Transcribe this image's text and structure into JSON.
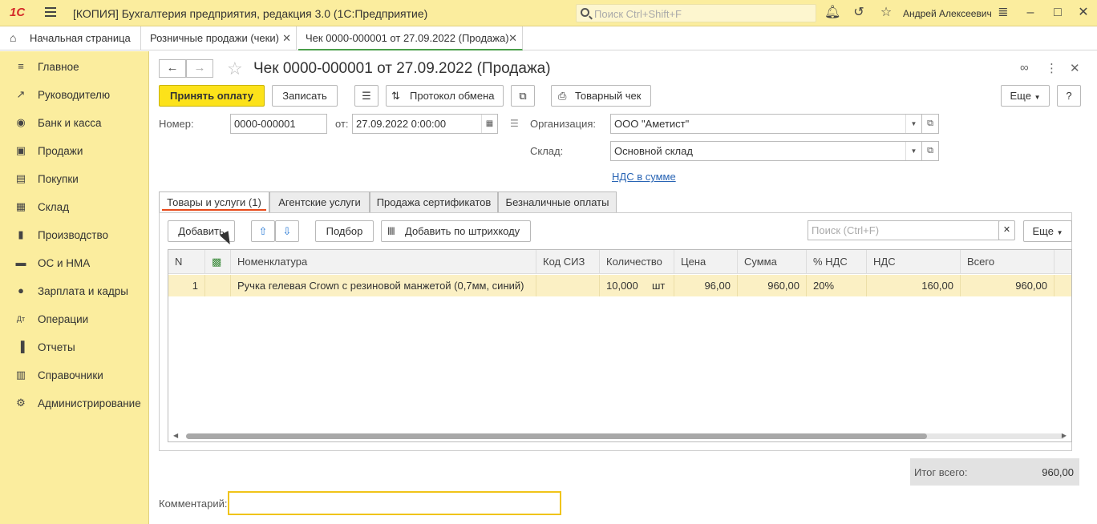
{
  "titlebar": {
    "logo": "1С",
    "title": "[КОПИЯ] Бухгалтерия предприятия, редакция 3.0  (1С:Предприятие)",
    "search_placeholder": "Поиск Ctrl+Shift+F",
    "user": "Андрей Алексеевич"
  },
  "tabs": [
    {
      "label": "Начальная страница"
    },
    {
      "label": "Розничные продажи (чеки)"
    },
    {
      "label": "Чек 0000-000001 от 27.09.2022 (Продажа)"
    }
  ],
  "sidebar": {
    "items": [
      {
        "label": "Главное",
        "icon": "menu-lines-icon"
      },
      {
        "label": "Руководителю",
        "icon": "trend-icon"
      },
      {
        "label": "Банк и касса",
        "icon": "coin-icon"
      },
      {
        "label": "Продажи",
        "icon": "bag-icon"
      },
      {
        "label": "Покупки",
        "icon": "cart-icon"
      },
      {
        "label": "Склад",
        "icon": "warehouse-icon"
      },
      {
        "label": "Производство",
        "icon": "factory-icon"
      },
      {
        "label": "ОС и НМА",
        "icon": "truck-icon"
      },
      {
        "label": "Зарплата и кадры",
        "icon": "person-icon"
      },
      {
        "label": "Операции",
        "icon": "dt-kt-icon"
      },
      {
        "label": "Отчеты",
        "icon": "bar-chart-icon"
      },
      {
        "label": "Справочники",
        "icon": "book-icon"
      },
      {
        "label": "Администрирование",
        "icon": "gear-icon"
      }
    ]
  },
  "document": {
    "title": "Чек 0000-000001 от 27.09.2022 (Продажа)",
    "toolbar": {
      "accept_payment": "Принять оплату",
      "save": "Записать",
      "exchange_log": "Протокол обмена",
      "sales_receipt": "Товарный чек",
      "more": "Еще",
      "help": "?"
    },
    "number_label": "Номер:",
    "number_value": "0000-000001",
    "date_label": "от:",
    "date_value": "27.09.2022  0:00:00",
    "org_label": "Организация:",
    "org_value": "ООО \"Аметист\"",
    "warehouse_label": "Склад:",
    "warehouse_value": "Основной склад",
    "vat_link": "НДС в сумме",
    "form_tabs": [
      {
        "label": "Товары и услуги (1)"
      },
      {
        "label": "Агентские услуги"
      },
      {
        "label": "Продажа сертификатов"
      },
      {
        "label": "Безналичные оплаты"
      }
    ],
    "table_toolbar": {
      "add": "Добавить",
      "pick": "Подбор",
      "add_by_barcode": "Добавить по штрихкоду",
      "search_placeholder": "Поиск (Ctrl+F)",
      "more": "Еще"
    },
    "columns": [
      "N",
      "Номенклатура",
      "Код СИЗ",
      "Количество",
      "Цена",
      "Сумма",
      "% НДС",
      "НДС",
      "Всего"
    ],
    "rows": [
      {
        "n": "1",
        "item": "Ручка гелевая Crown с резиновой манжетой (0,7мм, синий)",
        "code": "",
        "qty": "10,000",
        "unit": "шт",
        "price": "96,00",
        "sum": "960,00",
        "vat_rate": "20%",
        "vat": "160,00",
        "total": "960,00"
      }
    ],
    "total_label": "Итог всего:",
    "total_value": "960,00",
    "comment_label": "Комментарий:"
  }
}
